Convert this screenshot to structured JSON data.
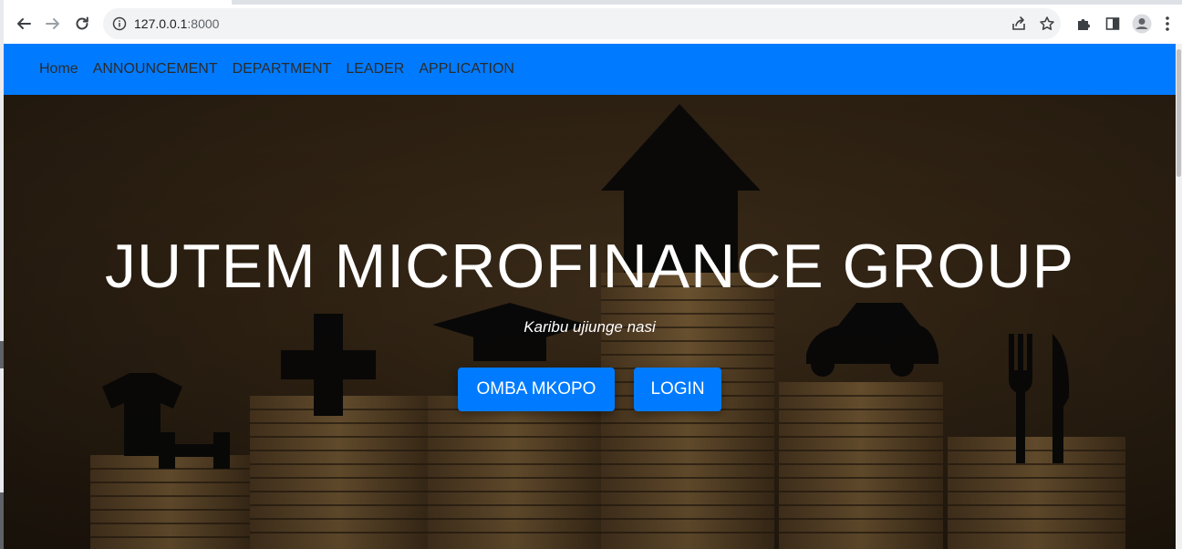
{
  "browser": {
    "url_host": "127.0.0.1",
    "url_port": ":8000",
    "icons": [
      "back-icon",
      "forward-icon",
      "reload-icon",
      "info-icon",
      "share-icon",
      "star-icon",
      "extensions-icon",
      "side-panel-icon",
      "profile-icon",
      "menu-icon"
    ]
  },
  "nav": {
    "brand_color": "#007bff",
    "items": [
      "Home",
      "ANNOUNCEMENT",
      "DEPARTMENT",
      "LEADER",
      "APPLICATION"
    ]
  },
  "hero": {
    "title": "JUTEM MICROFINANCE GROUP",
    "subtitle": "Karibu ujiunge nasi",
    "primary_button": "OMBA MKOPO",
    "login_button": "LOGIN",
    "button_color": "#007bff"
  }
}
